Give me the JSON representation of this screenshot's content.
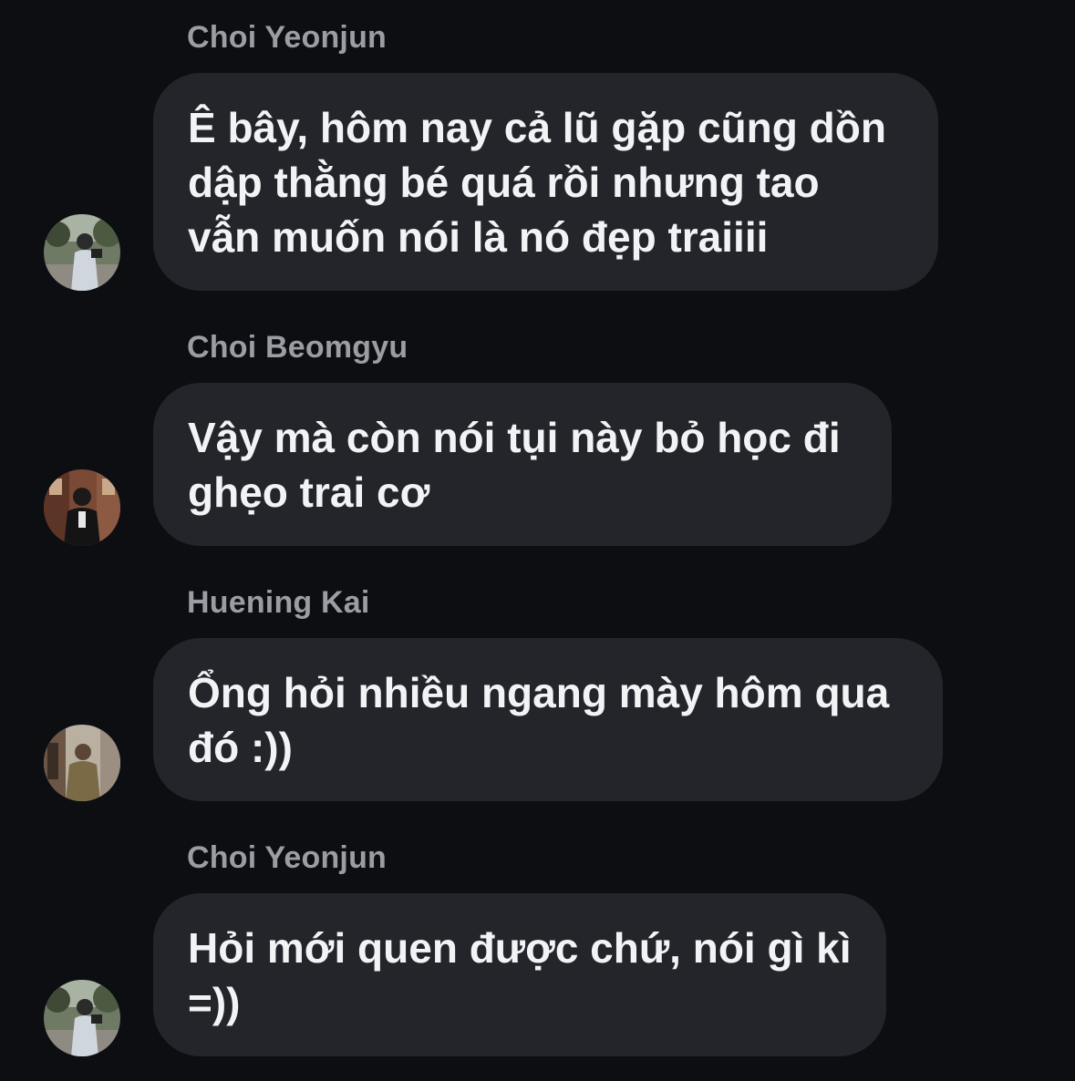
{
  "messages": [
    {
      "sender": "Choi Yeonjun",
      "text": "Ê bây, hôm nay cả lũ gặp cũng dồn\ndập thằng bé quá rồi nhưng tao\nvẫn muốn nói là nó đẹp traiiii",
      "avatar_icon": "user-photo-avatar"
    },
    {
      "sender": "Choi Beomgyu",
      "text": "Vậy mà còn nói tụi này bỏ học đi\nghẹo trai cơ",
      "avatar_icon": "user-photo-avatar"
    },
    {
      "sender": "Huening Kai",
      "text": "Ổng hỏi nhiều ngang mày hôm qua\nđó :))",
      "avatar_icon": "user-photo-avatar"
    },
    {
      "sender": "Choi Yeonjun",
      "text": "Hỏi mới quen được chứ, nói gì kì\n=))",
      "avatar_icon": "user-photo-avatar"
    }
  ],
  "colors": {
    "background": "#0d0e12",
    "bubble": "#23252b",
    "sender_text": "#9a9da3",
    "message_text": "#f2f3f5"
  }
}
